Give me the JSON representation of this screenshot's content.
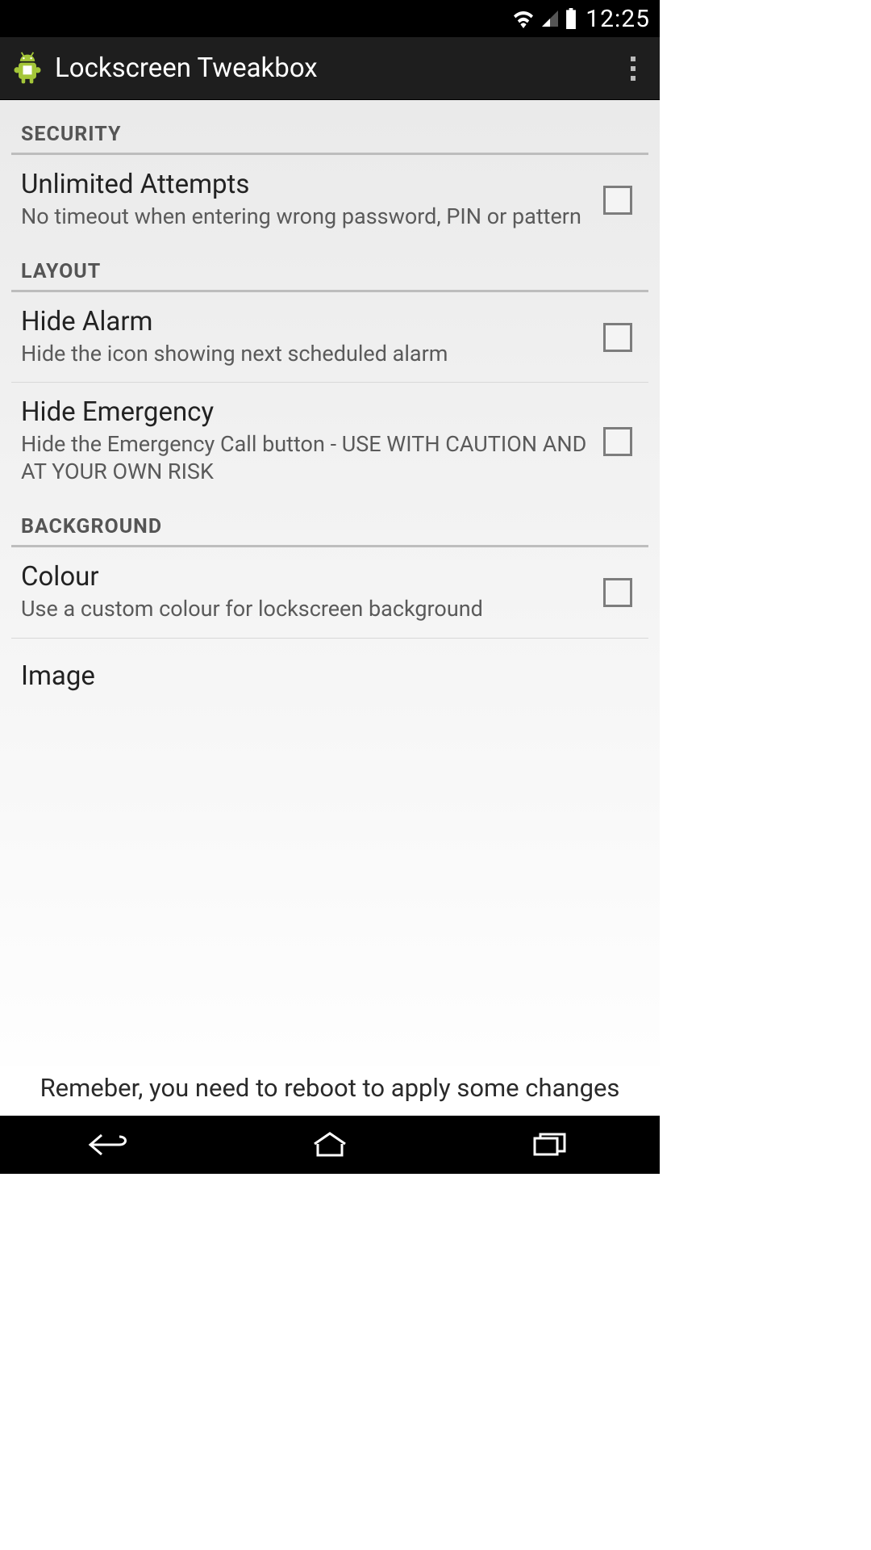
{
  "status_bar": {
    "time": "12:25"
  },
  "action_bar": {
    "title": "Lockscreen Tweakbox"
  },
  "sections": [
    {
      "header": "SECURITY",
      "items": [
        {
          "title": "Unlimited Attempts",
          "desc": "No timeout when entering wrong password, PIN or pattern",
          "checked": false
        }
      ]
    },
    {
      "header": "LAYOUT",
      "items": [
        {
          "title": "Hide Alarm",
          "desc": "Hide the icon showing next scheduled alarm",
          "checked": false
        },
        {
          "title": "Hide Emergency",
          "desc": "Hide the Emergency Call button - USE WITH CAUTION AND AT YOUR OWN RISK",
          "checked": false
        }
      ]
    },
    {
      "header": "BACKGROUND",
      "items": [
        {
          "title": "Colour",
          "desc": "Use a custom colour for lockscreen background",
          "checked": false
        },
        {
          "title": "Image",
          "desc": "",
          "checked": false
        }
      ]
    }
  ],
  "footer_note": "Remeber, you need to reboot to apply some changes"
}
